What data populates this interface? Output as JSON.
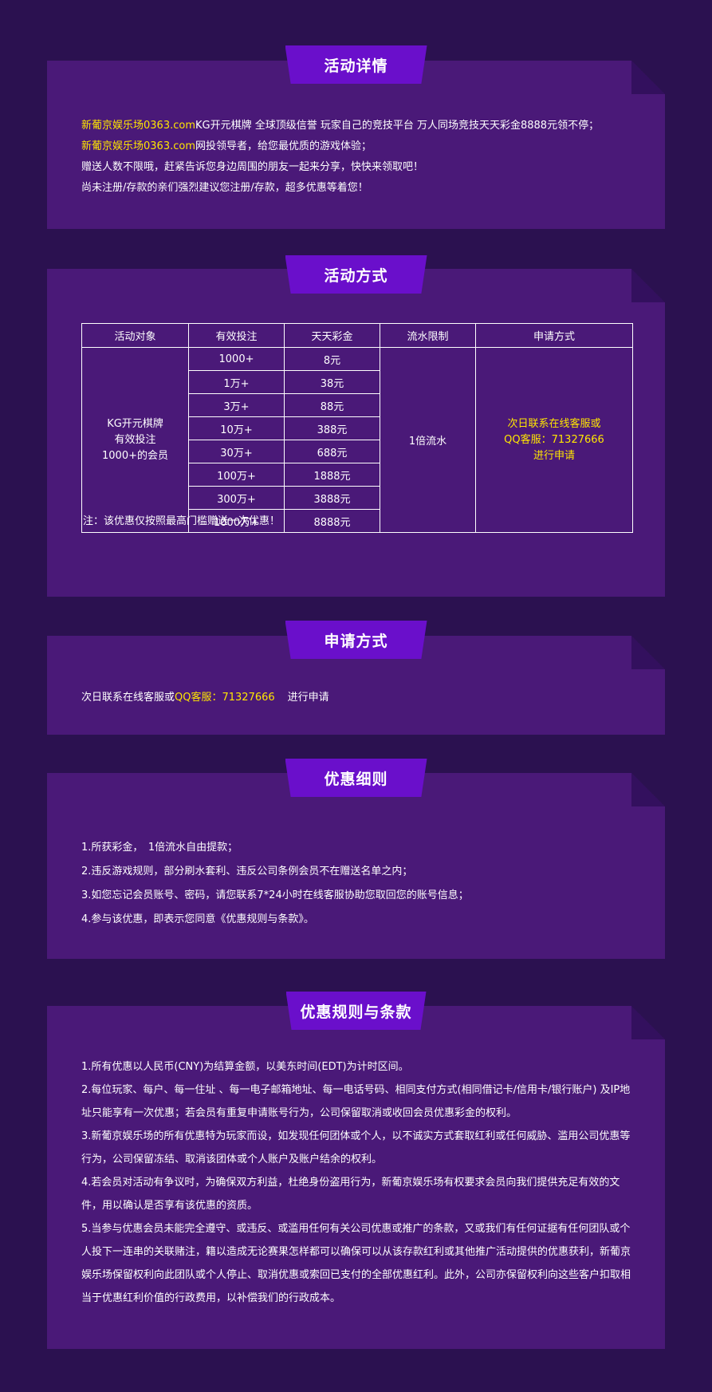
{
  "detail": {
    "title": "活动详情",
    "lines": [
      {
        "hl": "新葡京娱乐场0363.com",
        "text": "KG开元棋牌 全球顶级信誉 玩家自己的竞技平台 万人同场竞技天天彩金8888元领不停；"
      },
      {
        "hl": "新葡京娱乐场0363.com",
        "text": "网投领导者，给您最优质的游戏体验；"
      },
      {
        "hl": "",
        "text": "赠送人数不限哦，赶紧告诉您身边周围的朋友一起来分享，快快来领取吧！"
      },
      {
        "hl": "",
        "text": "尚未注册/存款的亲们强烈建议您注册/存款，超多优惠等着您！"
      }
    ]
  },
  "method": {
    "title": "活动方式",
    "headers": [
      "活动对象",
      "有效投注",
      "天天彩金",
      "流水限制",
      "申请方式"
    ],
    "target": [
      "KG开元棋牌",
      "有效投注",
      "1000+的会员"
    ],
    "rows": [
      {
        "bet": "1000+",
        "bonus": "8元"
      },
      {
        "bet": "1万+",
        "bonus": "38元"
      },
      {
        "bet": "3万+",
        "bonus": "88元"
      },
      {
        "bet": "10万+",
        "bonus": "388元"
      },
      {
        "bet": "30万+",
        "bonus": "688元"
      },
      {
        "bet": "100万+",
        "bonus": "1888元"
      },
      {
        "bet": "300万+",
        "bonus": "3888元"
      },
      {
        "bet": "1000万+",
        "bonus": "8888元"
      }
    ],
    "flow": "1倍流水",
    "apply": [
      "次日联系在线客服或",
      "QQ客服：71327666",
      "进行申请"
    ],
    "note": "注：该优惠仅按照最高门槛赠送一次优惠！"
  },
  "apply": {
    "title": "申请方式",
    "prefix": "次日联系在线客服或",
    "qq": "QQ客服：71327666",
    "suffix": "进行申请"
  },
  "details": {
    "title": "优惠细则",
    "items": [
      "1.所获彩金，　1倍流水自由提款；",
      "2.违反游戏规则，部分刷水套利、违反公司条例会员不在赠送名单之内；",
      "3.如您忘记会员账号、密码，请您联系7*24小时在线客服协助您取回您的账号信息；",
      "4.参与该优惠，即表示您同意《优惠规则与条款》。"
    ]
  },
  "terms": {
    "title": "优惠规则与条款",
    "items": [
      "1.所有优惠以人民币(CNY)为结算金额，以美东时间(EDT)为计时区间。",
      "2.每位玩家、每户、每一住址 、每一电子邮箱地址、每一电话号码、相同支付方式(相同借记卡/信用卡/银行账户) 及IP地址只能享有一次优惠；若会员有重复申请账号行为，公司保留取消或收回会员优惠彩金的权利。",
      "3.新葡京娱乐场的所有优惠特为玩家而设，如发现任何团体或个人，以不诚实方式套取红利或任何威胁、滥用公司优惠等行为，公司保留冻结、取消该团体或个人账户及账户结余的权利。",
      "4.若会员对活动有争议时，为确保双方利益，杜绝身份盗用行为，新葡京娱乐场有权要求会员向我们提供充足有效的文件，用以确认是否享有该优惠的资质。",
      "5.当参与优惠会员未能完全遵守、或违反、或滥用任何有关公司优惠或推广的条款，又或我们有任何证据有任何团队或个人投下一连串的关联赌注，籍以造成无论赛果怎样都可以确保可以从该存款红利或其他推广活动提供的优惠获利，新葡京娱乐场保留权利向此团队或个人停止、取消优惠或索回已支付的全部优惠红利。此外，公司亦保留权利向这些客户扣取相当于优惠红利价值的行政费用，以补偿我们的行政成本。"
    ]
  }
}
